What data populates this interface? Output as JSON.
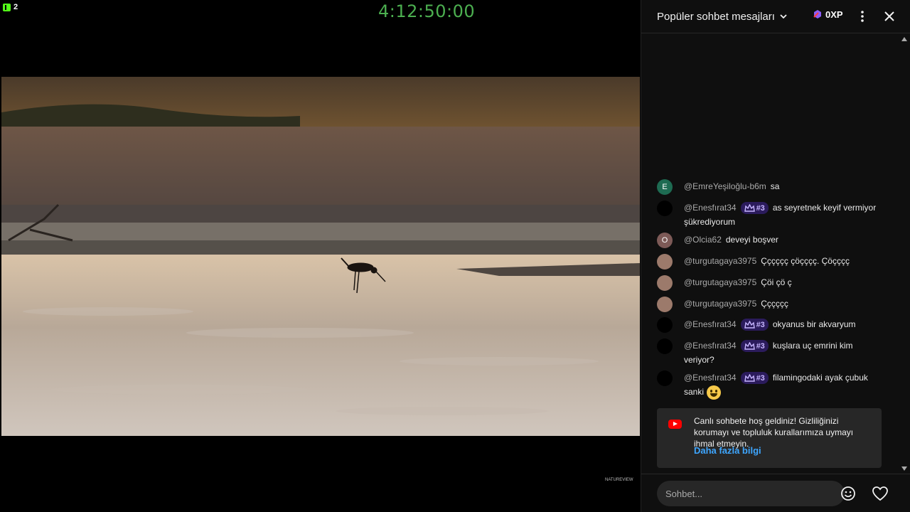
{
  "overlay": {
    "viewer_count": "2",
    "timer": "4:12:50:00",
    "watermark": "NATUREVIEW"
  },
  "chat": {
    "title": "Popüler sohbet mesajları",
    "xp_label": "0XP",
    "messages": [
      {
        "avatar_letter": "E",
        "avatar_color": "#1e6b52",
        "author": "@EmreYeşiloğlu-b6m",
        "badge": "",
        "text": "sa"
      },
      {
        "avatar_letter": "",
        "avatar_color": "#000000",
        "author": "@Enesfırat34",
        "badge": "#3",
        "text": "as seyretnek keyif vermiyor şükrediyorum"
      },
      {
        "avatar_letter": "O",
        "avatar_color": "#7d5a57",
        "author": "@Olcia62",
        "badge": "",
        "text": "deveyi boşver"
      },
      {
        "avatar_letter": "",
        "avatar_color": "#9c7a6b",
        "author": "@turgutagaya3975",
        "badge": "",
        "text": "Çççççç çöçççç. Çöçççç"
      },
      {
        "avatar_letter": "",
        "avatar_color": "#9c7a6b",
        "author": "@turgutagaya3975",
        "badge": "",
        "text": "Çöi çö ç"
      },
      {
        "avatar_letter": "",
        "avatar_color": "#9c7a6b",
        "author": "@turgutagaya3975",
        "badge": "",
        "text": "Çççççç"
      },
      {
        "avatar_letter": "",
        "avatar_color": "#000000",
        "author": "@Enesfırat34",
        "badge": "#3",
        "text": "okyanus bir akvaryum"
      },
      {
        "avatar_letter": "",
        "avatar_color": "#000000",
        "author": "@Enesfırat34",
        "badge": "#3",
        "text": "kuşlara uç emrini kim veriyor?"
      },
      {
        "avatar_letter": "",
        "avatar_color": "#000000",
        "author": "@Enesfırat34",
        "badge": "#3",
        "text": "filamingodaki ayak çubuk sanki"
      }
    ],
    "notice": {
      "text": "Canlı sohbete hoş geldiniz! Gizliliğinizi korumayı ve topluluk kurallarımıza uymayı ihmal etmeyin.",
      "link": "Daha fazla bilgi"
    },
    "input": {
      "placeholder": "Sohbet..."
    }
  }
}
